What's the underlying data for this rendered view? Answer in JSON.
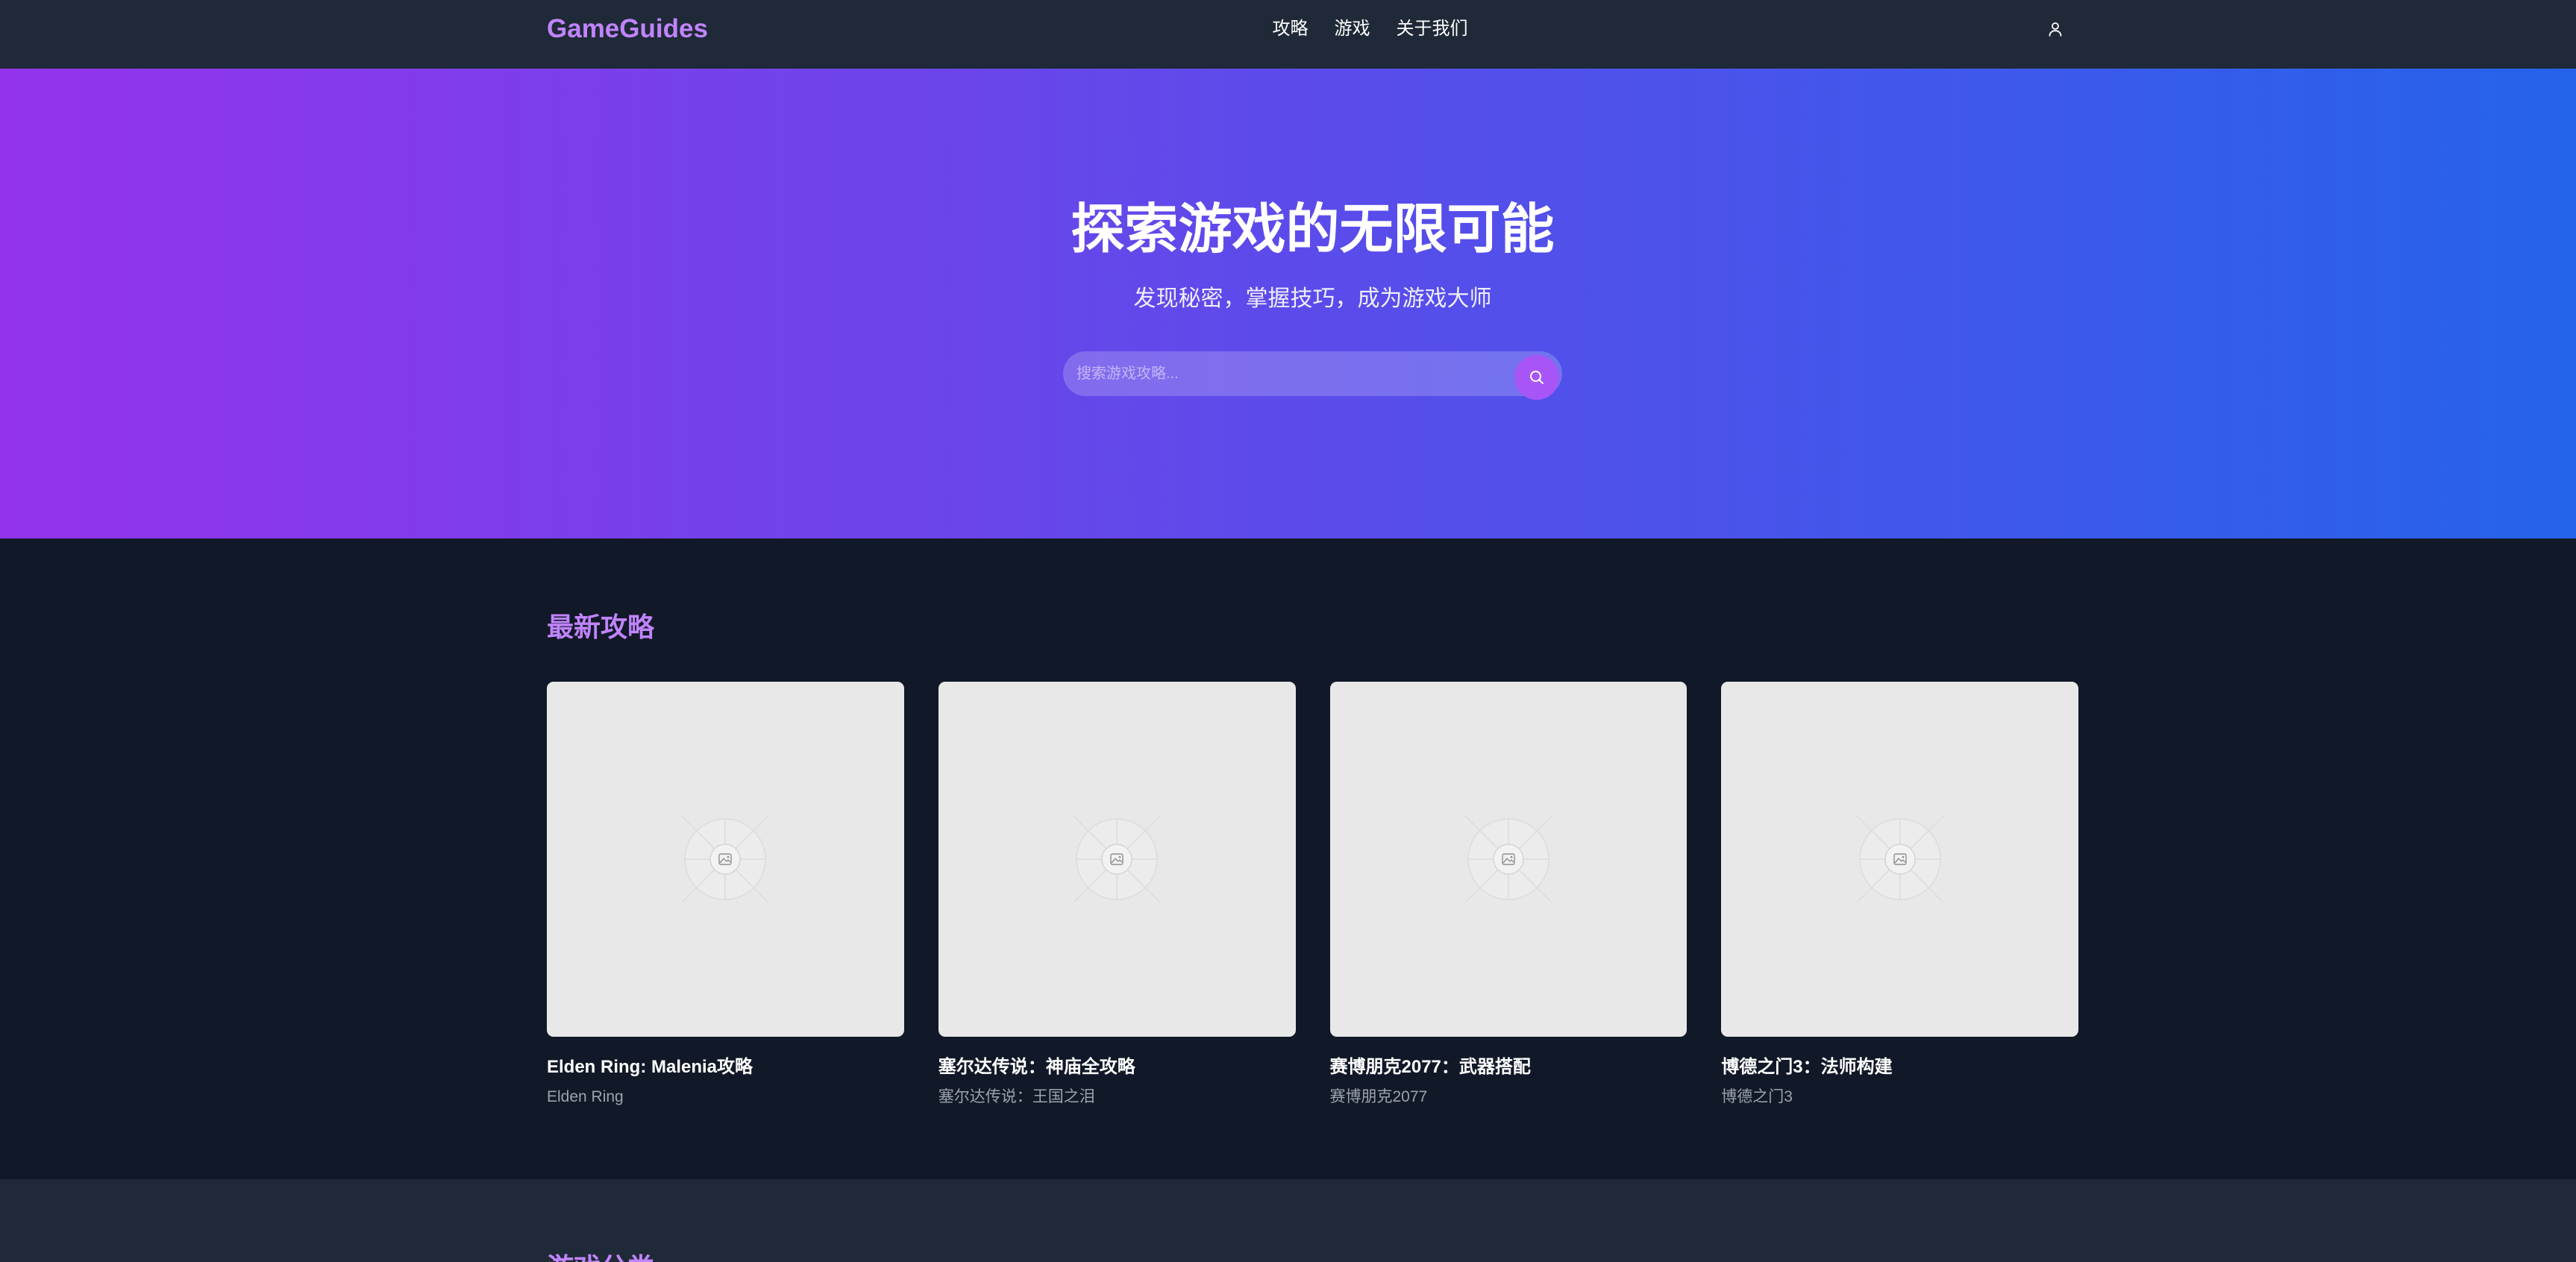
{
  "colors": {
    "header_bg": "#1f2937",
    "page_bg": "#111827",
    "accent": "#c084fc",
    "hero_from": "#9333ea",
    "hero_to": "#2563eb",
    "search_button": "#a855f7",
    "card_image_bg": "#e8e8e8",
    "muted_text": "#9ca3af"
  },
  "header": {
    "logo": "GameGuides",
    "nav": [
      {
        "label": "攻略"
      },
      {
        "label": "游戏"
      },
      {
        "label": "关于我们"
      }
    ],
    "user_icon": "user-icon"
  },
  "hero": {
    "title": "探索游戏的无限可能",
    "subtitle": "发现秘密，掌握技巧，成为游戏大师",
    "search": {
      "placeholder": "搜索游戏攻略...",
      "value": "",
      "icon": "search-icon"
    }
  },
  "latest_guides": {
    "heading": "最新攻略",
    "cards": [
      {
        "title": "Elden Ring: Malenia攻略",
        "game": "Elden Ring",
        "image_icon": "image-placeholder-icon"
      },
      {
        "title": "塞尔达传说：神庙全攻略",
        "game": "塞尔达传说：王国之泪",
        "image_icon": "image-placeholder-icon"
      },
      {
        "title": "赛博朋克2077：武器搭配",
        "game": "赛博朋克2077",
        "image_icon": "image-placeholder-icon"
      },
      {
        "title": "博德之门3：法师构建",
        "game": "博德之门3",
        "image_icon": "image-placeholder-icon"
      }
    ]
  },
  "categories": {
    "heading": "游戏分类"
  }
}
